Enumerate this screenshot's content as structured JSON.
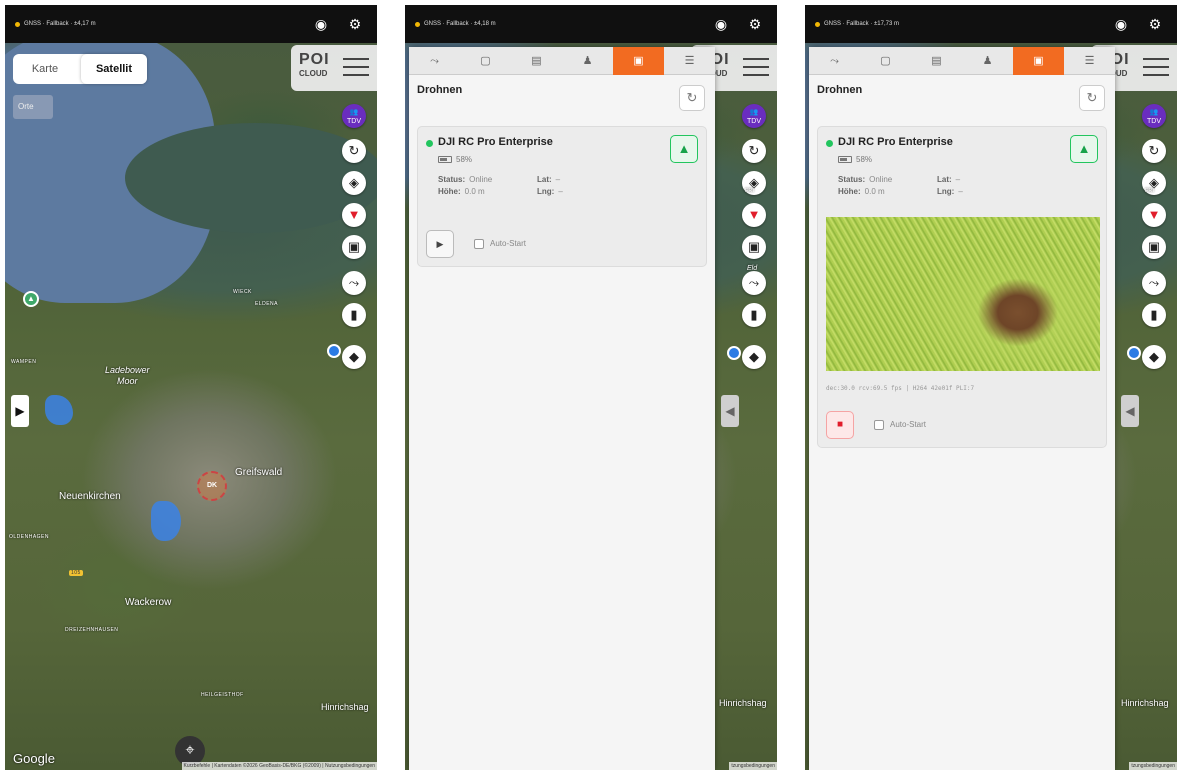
{
  "status_bar": [
    {
      "gnss": "GNSS · Fallback · ±4,17 m"
    },
    {
      "gnss": "GNSS · Fallback · ±4,18 m"
    },
    {
      "gnss": "GNSS · Fallback · ±17,73 m"
    }
  ],
  "logo": {
    "title": "POI",
    "sub": "CLOUD"
  },
  "map_toggle": {
    "karte": "Karte",
    "satellit": "Satellit"
  },
  "orte": "Orte",
  "tdv": "TDV",
  "map_labels": {
    "wieck": "WIECK",
    "eldena": "ELDENA",
    "wampen": "WAMPEN",
    "ladebow": "Ladebower",
    "moor": "Moor",
    "greifswald": "Greifswald",
    "neuenkirchen": "Neuenkirchen",
    "oldenhagen": "OLDENHAGEN",
    "road105": "105",
    "wackerow": "Wackerow",
    "dreizehnhausen": "DREIZEHNHAUSEN",
    "heilgeisthof": "HEILGEISTHOF",
    "hinrichshag": "Hinrichshag",
    "fri": "FRI",
    "eld": "Eld",
    "dk": "DK"
  },
  "google": "Google",
  "attribution_full": "Kurzbefehle | Kartendaten ©2026 GeoBasis-DE/BKG (©2009) | Nutzungsbedingungen",
  "attribution_short": "tzungsbedingungen",
  "panel": {
    "title": "Drohnen",
    "tabs": [
      "route-icon",
      "box-icon",
      "list-icon",
      "person-icon",
      "drone-icon",
      "layers-icon"
    ]
  },
  "drone": {
    "name": "DJI RC Pro Enterprise",
    "battery": "58%",
    "status_label": "Status:",
    "status_value": "Online",
    "height_label": "Höhe:",
    "height_value": "0.0 m",
    "lat_label": "Lat:",
    "lat_value": "–",
    "lng_label": "Lng:",
    "lng_value": "–",
    "auto_start": "Auto-Start",
    "video_stats": "dec:30.0 rcv:69.5 fps | H264 42e01f PLI:7"
  },
  "colors": {
    "accent": "#f26b21",
    "online": "#22c55e",
    "tdv": "#6a2dbf",
    "filter": "#e11d2b"
  }
}
